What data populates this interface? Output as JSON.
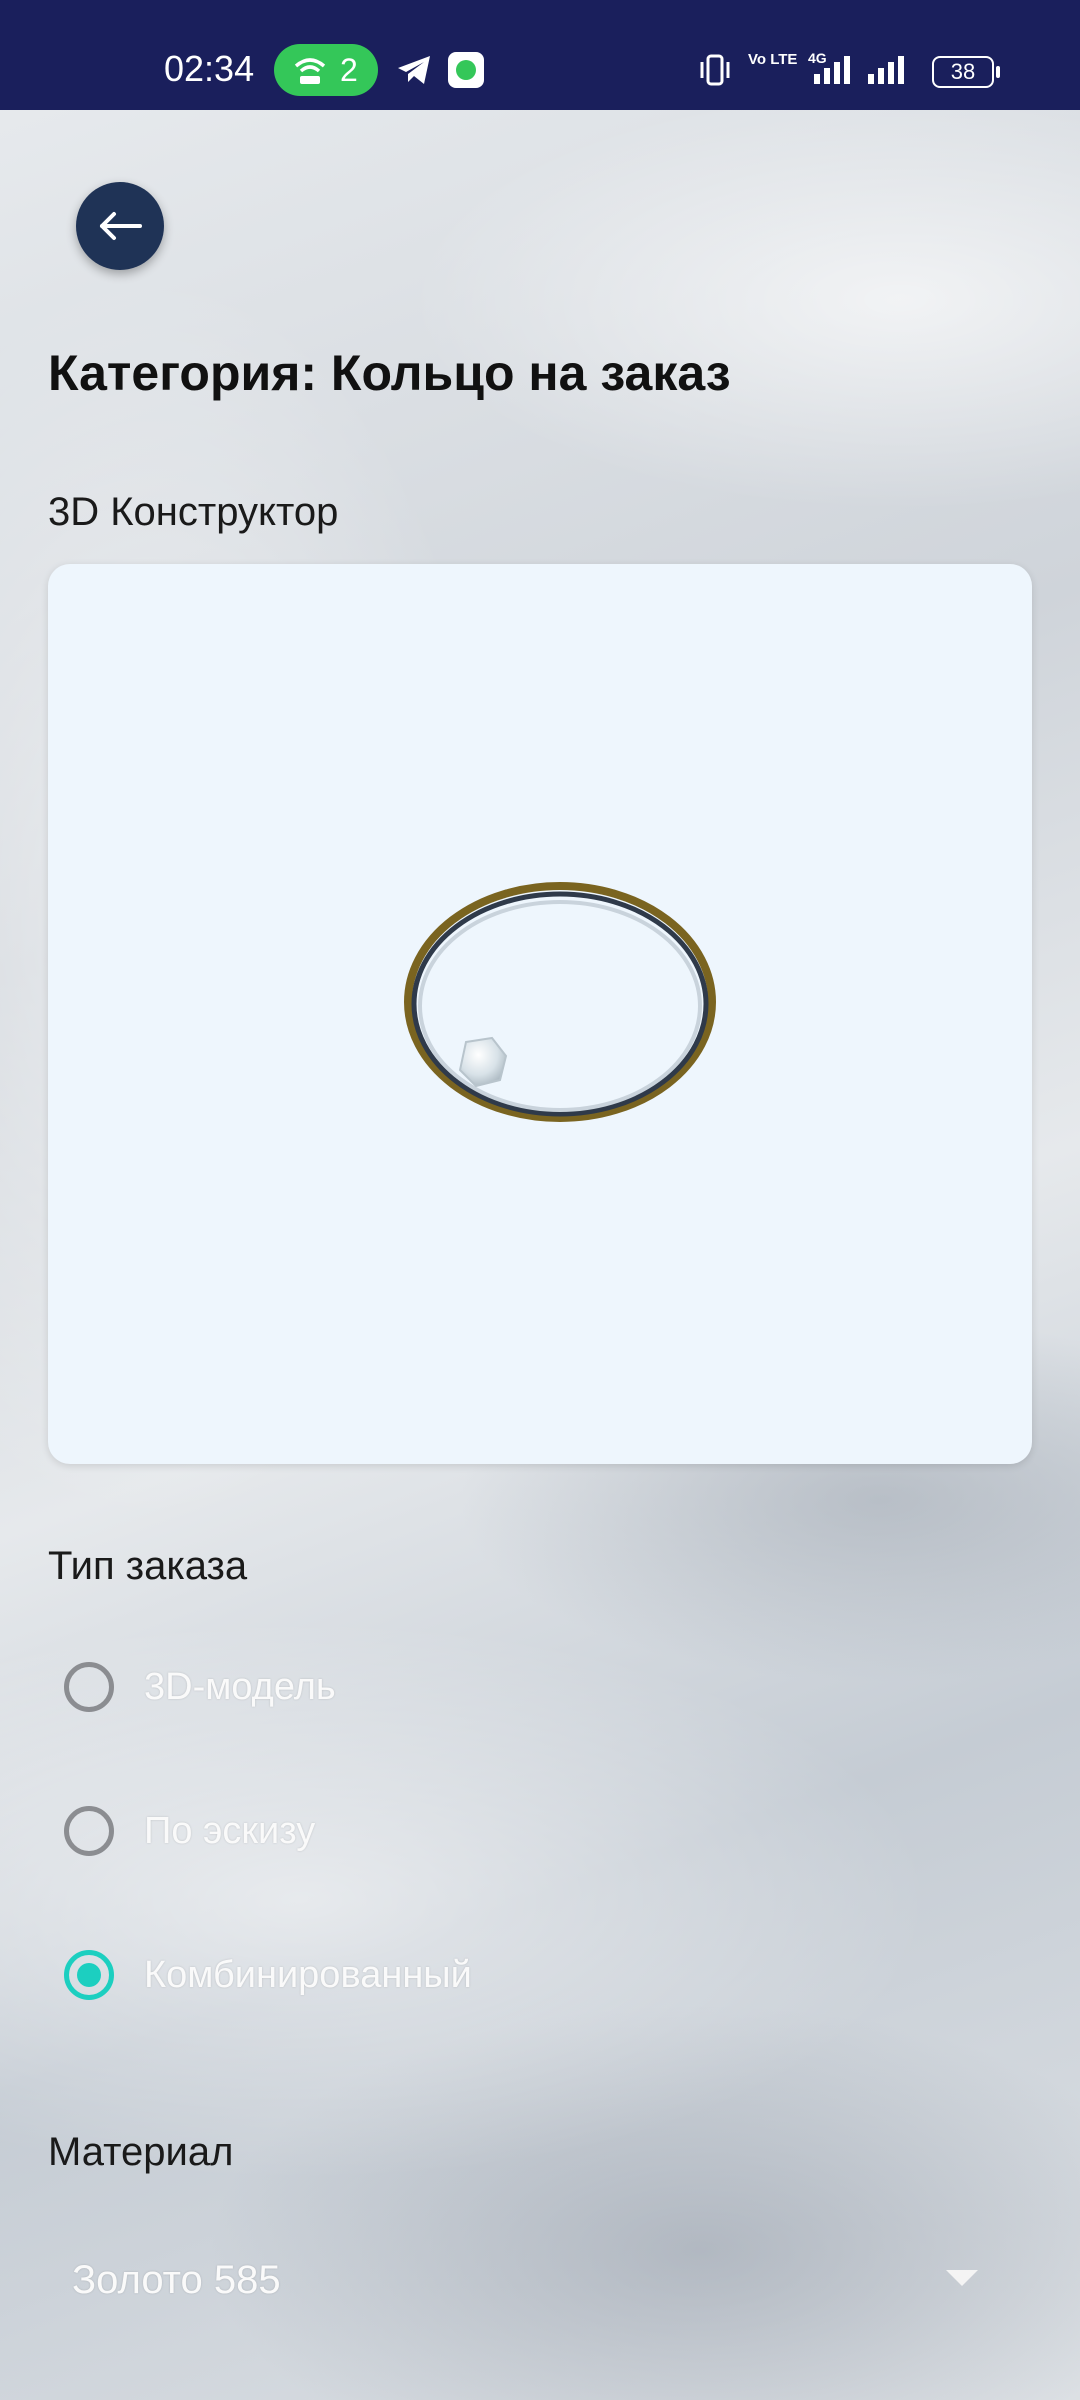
{
  "status_bar": {
    "time": "02:34",
    "hotspot_count": "2",
    "network": "4G",
    "volte": "Vo LTE",
    "battery": "38"
  },
  "header": {
    "title": "Категория: Кольцо на заказ"
  },
  "constructor": {
    "label": "3D Конструктор"
  },
  "order_type": {
    "label": "Тип заказа",
    "options": [
      "3D-модель",
      "По эскизу",
      "Комбинированный"
    ],
    "selected": "Комбинированный"
  },
  "material": {
    "label": "Материал",
    "value": "Золото 585"
  },
  "colors": {
    "status_bar": "#1a1f5c",
    "accent": "#1ccfc0",
    "back_button": "#1f3356",
    "viewer_bg": "#eef6fd"
  },
  "icons": [
    "back-arrow-icon",
    "hotspot-icon",
    "telegram-icon",
    "messenger-icon",
    "vibrate-icon",
    "signal-icon",
    "battery-icon",
    "chevron-down-icon"
  ]
}
